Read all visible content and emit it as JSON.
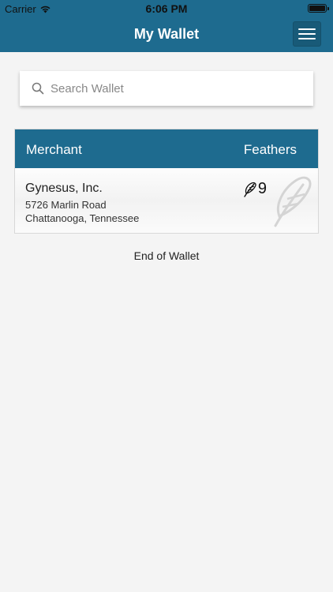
{
  "status_bar": {
    "carrier": "Carrier",
    "time": "6:06 PM",
    "wifi_icon": "wifi-icon",
    "battery_icon": "battery-icon"
  },
  "navbar": {
    "title": "My Wallet",
    "menu_icon": "hamburger-menu-icon",
    "color": "#1e6b8f"
  },
  "search": {
    "placeholder": "Search Wallet",
    "value": "",
    "icon": "search-icon"
  },
  "table": {
    "columns": [
      "Merchant",
      "Feathers"
    ],
    "rows": [
      {
        "name": "Gynesus, Inc.",
        "address_line1": "5726 Marlin Road",
        "address_line2": "Chattanooga, Tennessee",
        "feathers": "9",
        "icon": "feather-icon"
      }
    ]
  },
  "footer": {
    "end_text": "End of Wallet"
  }
}
